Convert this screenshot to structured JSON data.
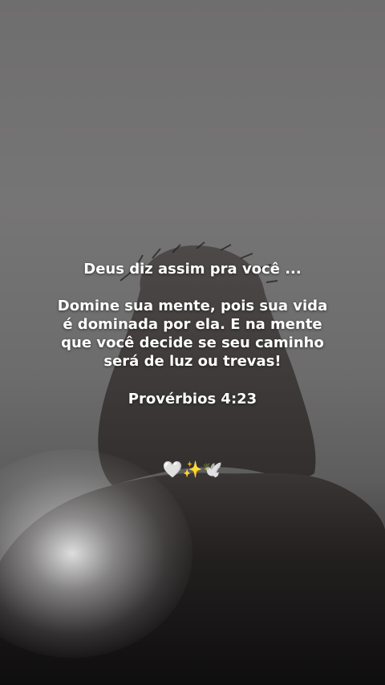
{
  "post": {
    "headline": "Deus diz assim pra você ...",
    "verse_lines": [
      "Domine sua mente, pois sua vida",
      "é dominada por ela. E na mente",
      "que você decide se seu caminho",
      "será de luz ou trevas!"
    ],
    "reference": "Provérbios 4:23",
    "emojis": "🤍✨🕊️"
  },
  "colors": {
    "background": "#767575",
    "text": "#ffffff",
    "silhouette": "#141313"
  }
}
